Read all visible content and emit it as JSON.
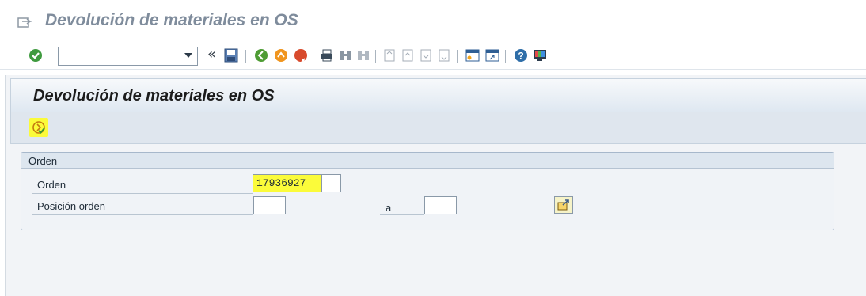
{
  "window": {
    "title": "Devolución de materiales en OS"
  },
  "toolbar": {
    "command_field_value": "",
    "chevron_label": "«"
  },
  "page": {
    "title": "Devolución de materiales en OS"
  },
  "group": {
    "title": "Orden",
    "fields": {
      "orden_label": "Orden",
      "orden_value": "17936927",
      "posicion_label": "Posición orden",
      "posicion_from_value": "",
      "to_label": "a",
      "posicion_to_value": ""
    }
  },
  "colors": {
    "highlight": "#fbfb3a",
    "header": "#dfe8f1",
    "title_gray": "#7f8c9c"
  }
}
